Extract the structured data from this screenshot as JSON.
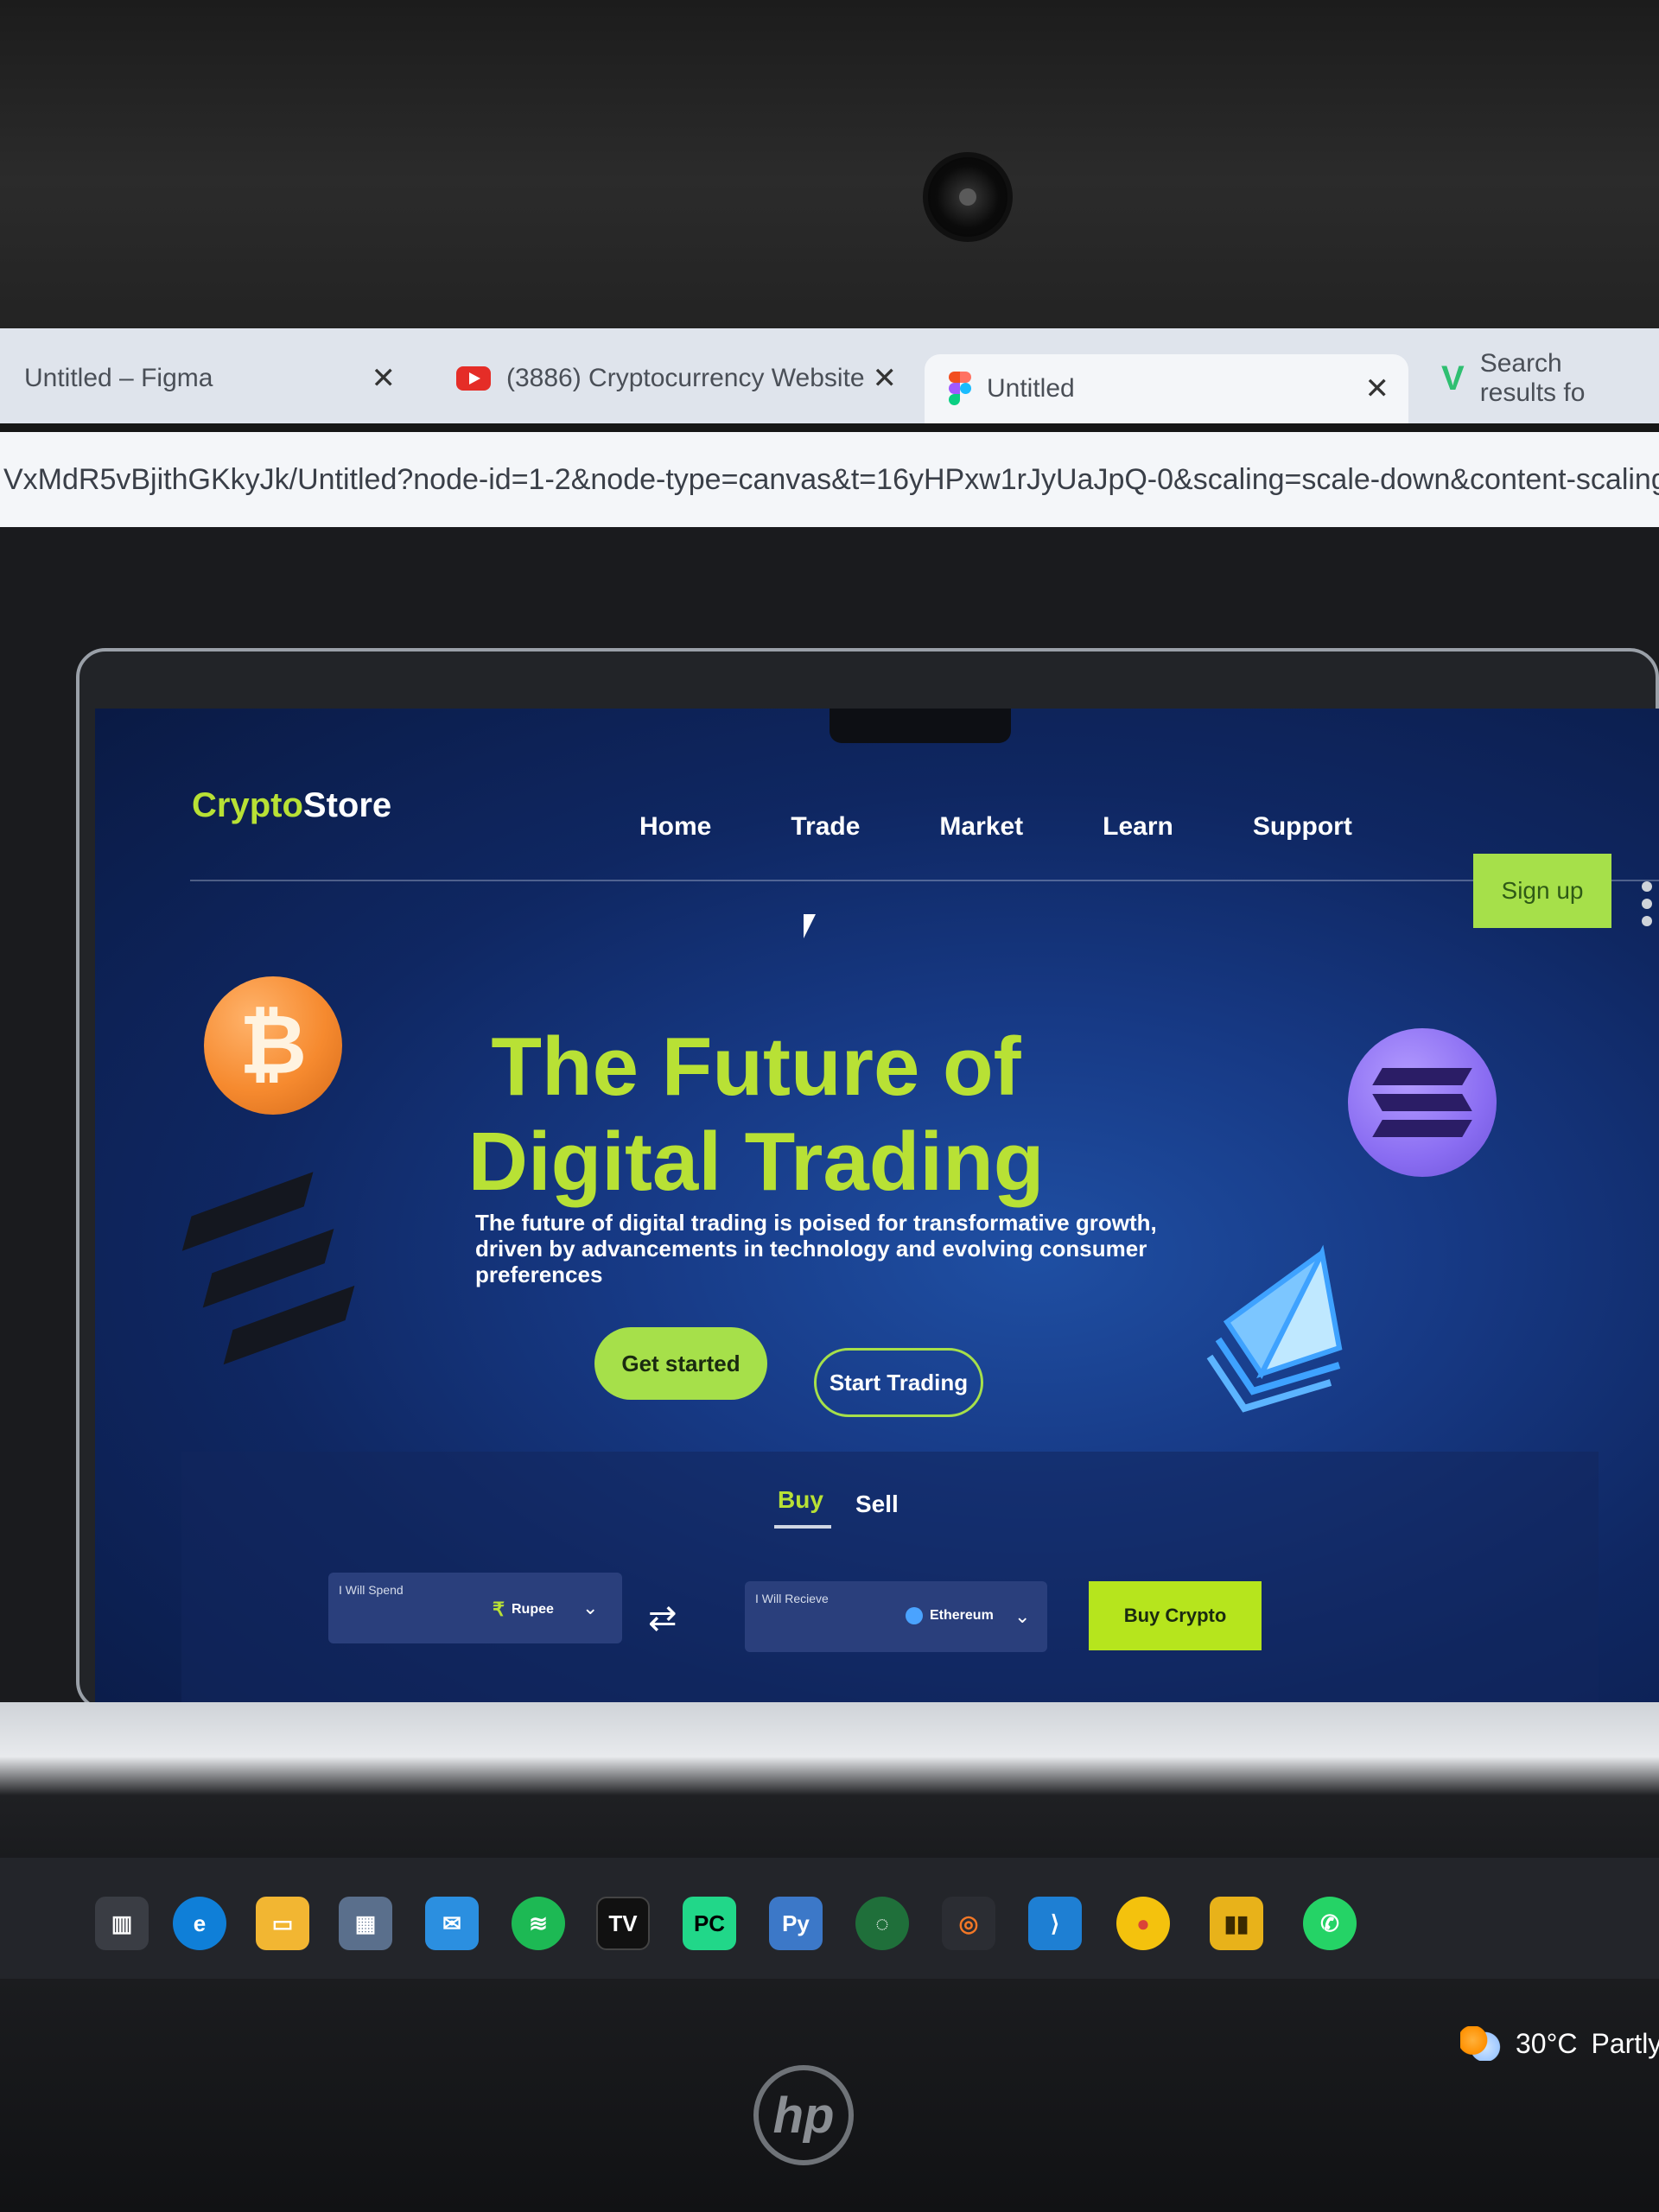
{
  "browser": {
    "tabs": [
      {
        "title": "Untitled – Figma"
      },
      {
        "title": "(3886) Cryptocurrency Website"
      },
      {
        "title": "Untitled"
      },
      {
        "title": "Search results fo"
      }
    ],
    "url": "VxMdR5vBjithGKkyJk/Untitled?node-id=1-2&node-type=canvas&t=16yHPxw1rJyUaJpQ-0&scaling=scale-down&content-scaling=fi"
  },
  "site": {
    "logo": {
      "part1": "Crypto",
      "part2": "Store"
    },
    "nav": [
      "Home",
      "Trade",
      "Market",
      "Learn",
      "Support"
    ],
    "signup_label": "Sign up",
    "hero": {
      "title_line1": "The Future of",
      "title_line2": "Digital Trading",
      "subtitle": "The future of digital trading is poised for transformative growth, driven by advancements in technology and evolving consumer preferences"
    },
    "cta_primary": "Get started",
    "cta_secondary": "Start Trading",
    "trade": {
      "tab_buy": "Buy",
      "tab_sell": "Sell",
      "spend_label": "I Will Spend",
      "spend_currency": "Rupee",
      "receive_label": "I Will Recieve",
      "receive_currency": "Ethereum",
      "buy_button": "Buy Crypto"
    }
  },
  "taskbar": {
    "weather_temp": "30°C",
    "weather_text": "Partly"
  },
  "colors": {
    "accent_green": "#a6e04a",
    "hero_title": "#b8e135",
    "screen_blue": "#173a86"
  }
}
